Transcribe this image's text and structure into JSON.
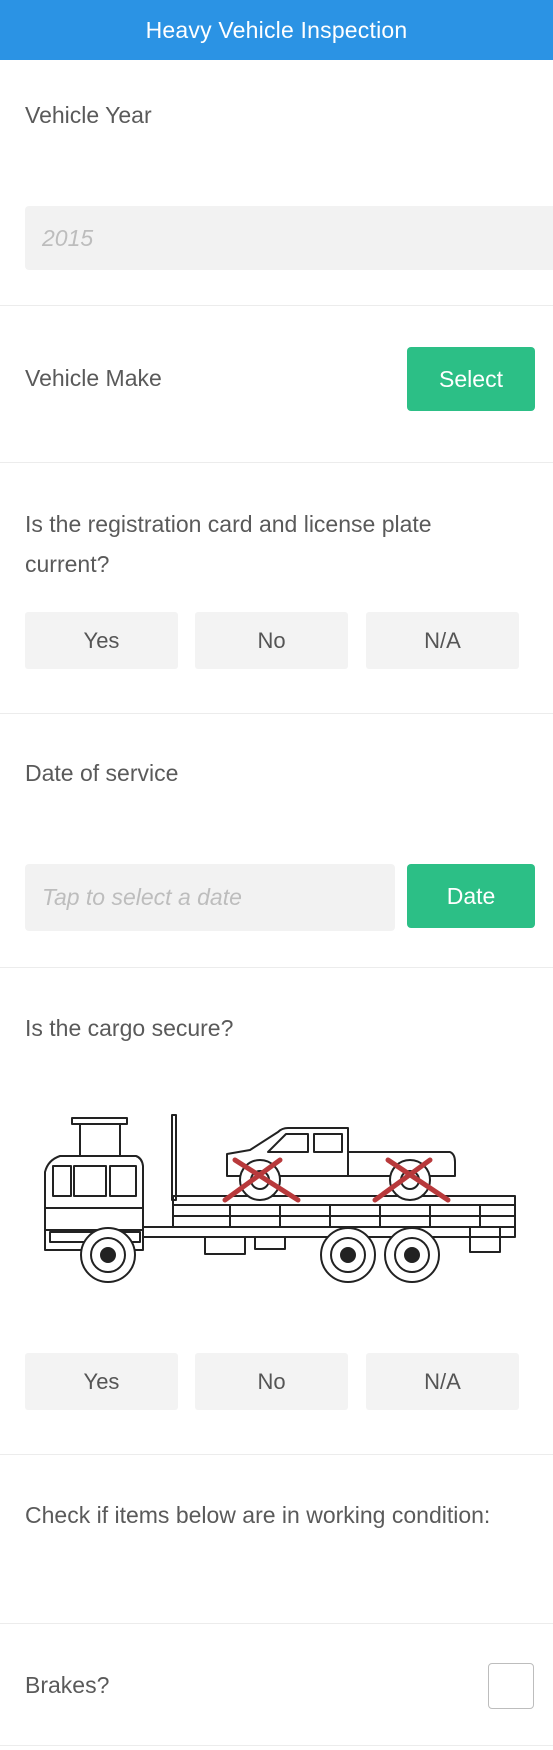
{
  "header": {
    "title": "Heavy Vehicle Inspection"
  },
  "vehicle_year": {
    "label": "Vehicle Year",
    "placeholder": "2015"
  },
  "vehicle_make": {
    "label": "Vehicle Make",
    "button": "Select"
  },
  "registration": {
    "question_line1": "Is the registration card and license plate",
    "question_line2": "current?",
    "options": [
      "Yes",
      "No",
      "N/A"
    ]
  },
  "service_date": {
    "label": "Date of service",
    "placeholder": "Tap to select a date",
    "button": "Date"
  },
  "cargo": {
    "question": "Is the cargo secure?",
    "options": [
      "Yes",
      "No",
      "N/A"
    ]
  },
  "checklist": {
    "heading": "Check if items below are in working condition:"
  },
  "brakes": {
    "label": "Brakes?"
  },
  "colors": {
    "header": "#2b93e4",
    "accent_green": "#2cbf86",
    "field_bg": "#f2f2f2",
    "strap_red": "#b8393b"
  }
}
